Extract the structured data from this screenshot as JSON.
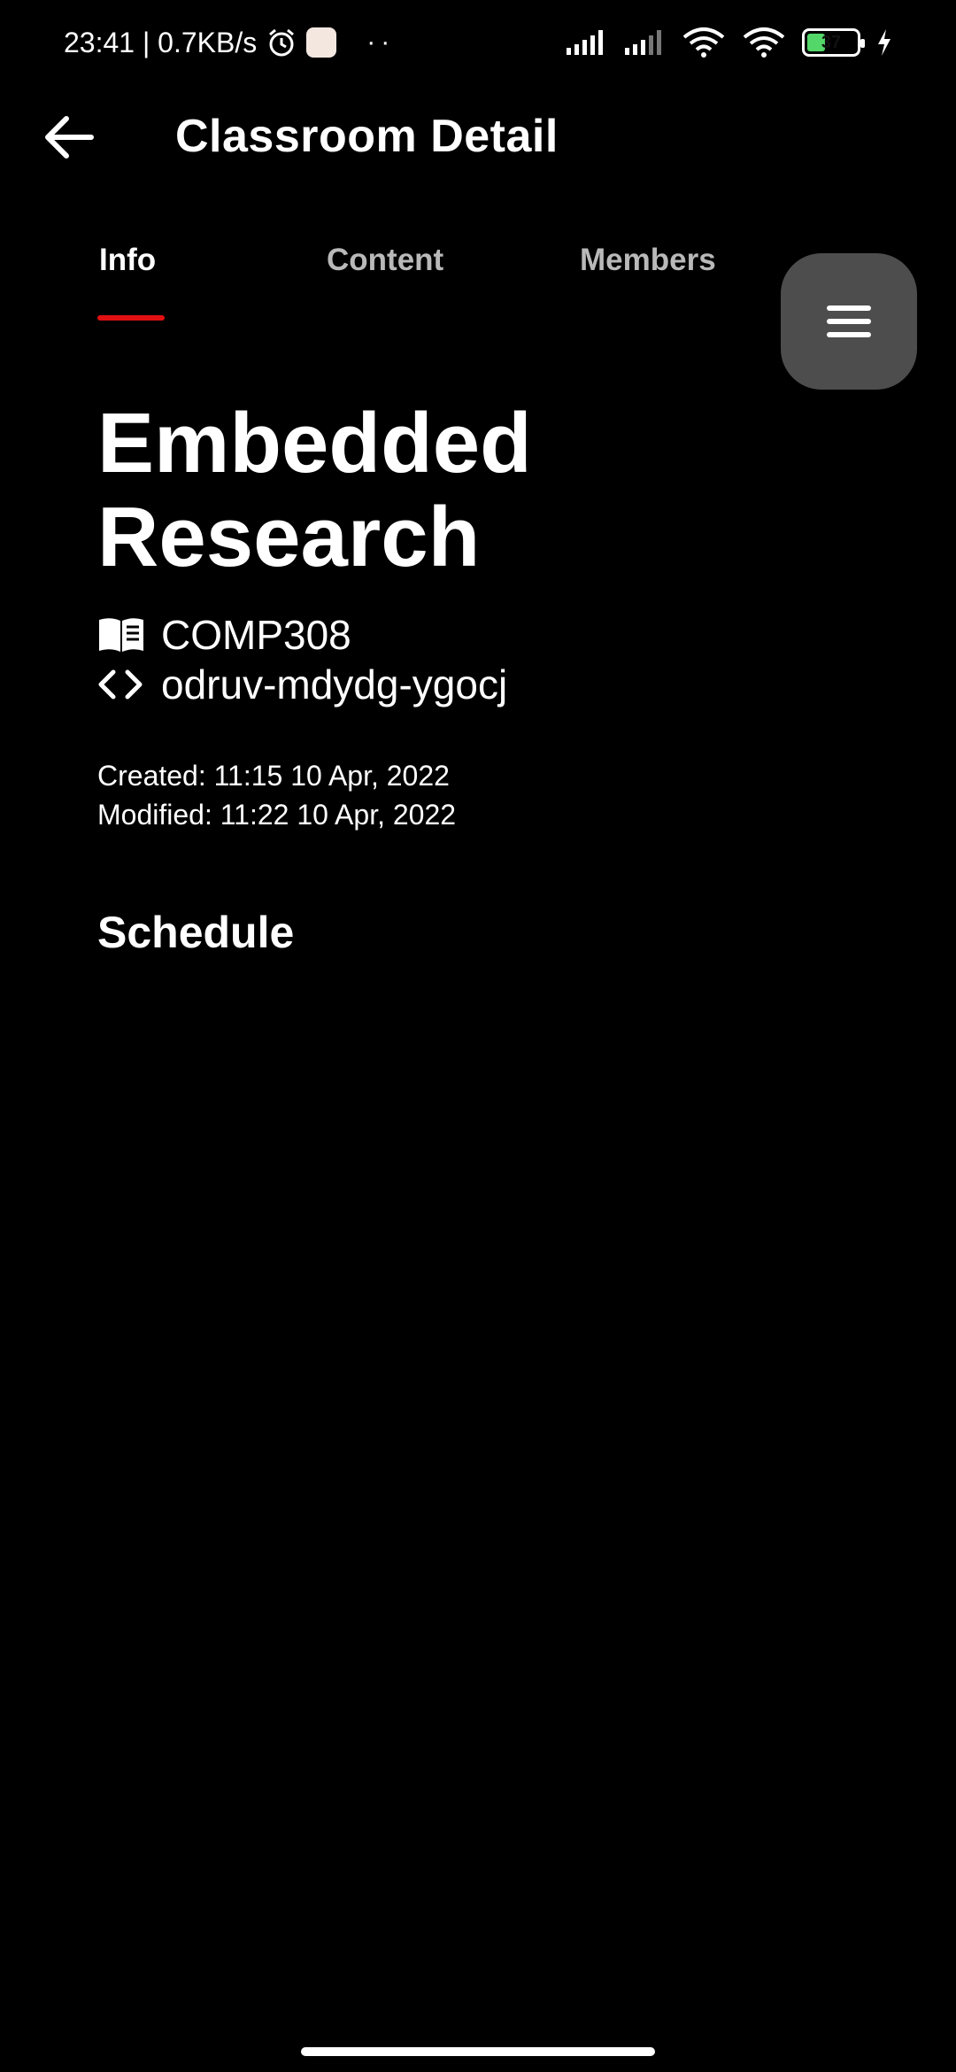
{
  "status_bar": {
    "time_and_speed": "23:41 | 0.7KB/s",
    "battery_level": "37",
    "battery_fill_percent": 37
  },
  "header": {
    "title": "Classroom Detail"
  },
  "tabs": [
    {
      "label": "Info",
      "active": true
    },
    {
      "label": "Content",
      "active": false
    },
    {
      "label": "Members",
      "active": false
    }
  ],
  "classroom": {
    "name": "Embedded Research",
    "course_code": "COMP308",
    "join_code": "odruv-mdydg-ygocj",
    "created": "Created: 11:15 10 Apr, 2022",
    "modified": "Modified: 11:22 10 Apr, 2022"
  },
  "sections": {
    "schedule_title": "Schedule"
  },
  "icons": {
    "back": "arrow-left-icon",
    "menu": "hamburger-menu-icon",
    "course": "book-icon",
    "code": "code-brackets-icon"
  },
  "colors": {
    "background": "#000000",
    "accent": "#e01010",
    "fab": "#4d4d4d"
  }
}
